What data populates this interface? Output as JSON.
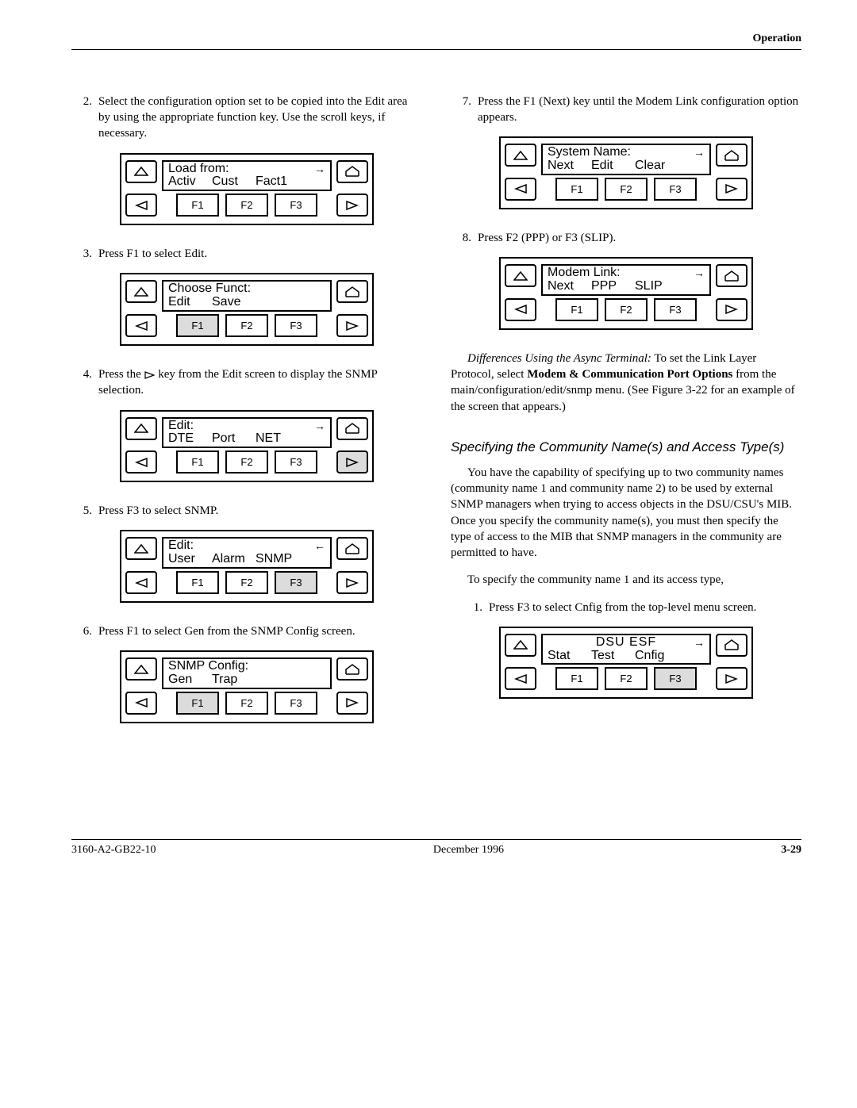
{
  "header": {
    "section": "Operation"
  },
  "left": {
    "steps": [
      {
        "n": "2.",
        "text": "Select the configuration option set to be copied into the Edit area by using the appropriate function key. Use the scroll keys, if necessary."
      },
      {
        "n": "3.",
        "text": "Press F1 to select Edit."
      },
      {
        "n": "4.",
        "text_pre": "Press the ",
        "text_post": " key from the Edit screen to display the SNMP selection."
      },
      {
        "n": "5.",
        "text": "Press F3 to select SNMP."
      },
      {
        "n": "6.",
        "text": "Press F1 to select Gen from the SNMP Config screen."
      }
    ],
    "panels": [
      {
        "title": "Load from:",
        "opts": [
          "Activ",
          "Cust",
          "Fact1"
        ],
        "arrow": "r",
        "hl": null
      },
      {
        "title": "Choose Funct:",
        "opts": [
          "Edit",
          "Save",
          ""
        ],
        "arrow": null,
        "hl": 0
      },
      {
        "title": "Edit:",
        "opts": [
          "DTE",
          "Port",
          "NET"
        ],
        "arrow": "r",
        "hl": null,
        "hl_nav_right": true
      },
      {
        "title": "Edit:",
        "opts": [
          "User",
          "Alarm",
          "SNMP"
        ],
        "arrow": "l",
        "hl": 2
      },
      {
        "title": "SNMP Config:",
        "opts": [
          "Gen",
          "Trap",
          ""
        ],
        "arrow": null,
        "hl": 0
      }
    ]
  },
  "right": {
    "steps": [
      {
        "n": "7.",
        "text": "Press the F1 (Next) key until the Modem Link configuration option appears."
      },
      {
        "n": "8.",
        "text": "Press F2 (PPP) or F3 (SLIP)."
      }
    ],
    "panels": [
      {
        "title": "System Name:",
        "opts": [
          "Next",
          "Edit",
          "Clear"
        ],
        "arrow": "r",
        "hl": null
      },
      {
        "title": "Modem Link:",
        "opts": [
          "Next",
          "PPP",
          "SLIP"
        ],
        "arrow": "r",
        "hl": null
      }
    ],
    "diff_para_em": "Differences Using the Async Terminal:",
    "diff_para_rest": " To set the Link Layer Protocol, select ",
    "diff_para_bold": "Modem & Communication Port Options",
    "diff_para_tail": " from the main/configuration/edit/snmp menu. (See Figure 3-22 for an example of the screen that appears.)",
    "subhead": "Specifying the Community Name(s) and Access Type(s)",
    "para1": "You have the capability of specifying up to two community names (community name 1 and community name 2) to be used by external SNMP managers when trying to access objects in the DSU/CSU's MIB. Once you specify the community name(s), you must then specify the type of access to the MIB that SNMP managers in the community are permitted to have.",
    "para2": "To specify the community name 1 and its access type,",
    "step_r3": {
      "n": "1.",
      "text": "Press F3 to select Cnfig from the top-level menu screen."
    },
    "panel_r3": {
      "center_top": "DSU ESF",
      "opts": [
        "Stat",
        "Test",
        "Cnfig"
      ],
      "arrow": "r",
      "hl": 2
    }
  },
  "fkeys": [
    "F1",
    "F2",
    "F3"
  ],
  "footer": {
    "left": "3160-A2-GB22-10",
    "center": "December 1996",
    "right": "3-29"
  }
}
